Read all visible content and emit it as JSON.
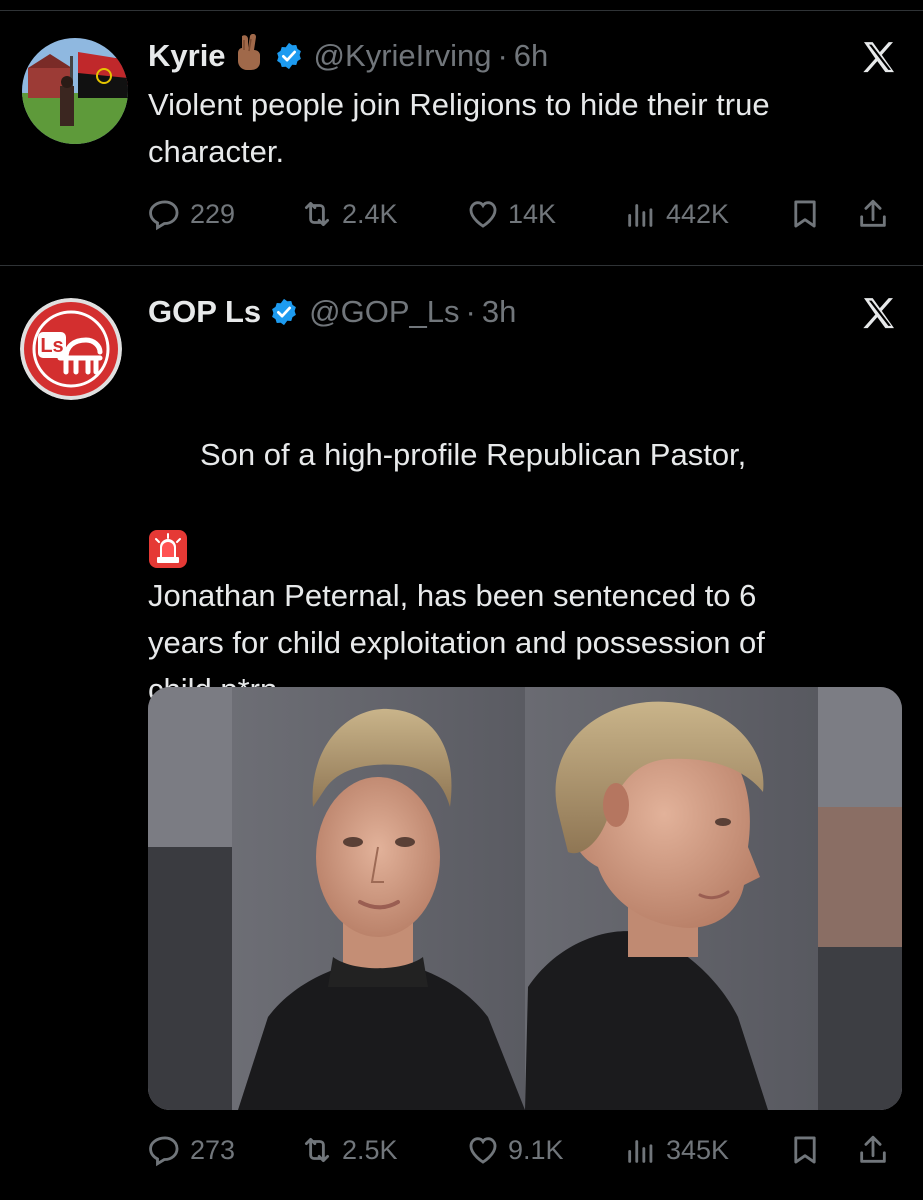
{
  "tweets": [
    {
      "name": "Kyrie",
      "handle": "@KyrieIrving",
      "separator": "·",
      "time": "6h",
      "text": "Violent people join Religions to hide their true\ncharacter.",
      "replies": "229",
      "retweets": "2.4K",
      "likes": "14K",
      "views": "442K"
    },
    {
      "name": "GOP Ls",
      "handle": "@GOP_Ls",
      "separator": "·",
      "time": "3h",
      "avatar_letters": "Ls",
      "text_line1": "Son of a high-profile Republican Pastor,",
      "text_rest": "Jonathan Peternal, has been sentenced to 6\nyears for child exploitation and possession of\nchild p*rn.\n\nHe distributed the illicit material in a\nSnapchat group called \"Diddy Disciples.\"",
      "replies": "273",
      "retweets": "2.5K",
      "likes": "9.1K",
      "views": "345K"
    }
  ],
  "icons": {
    "verified": "verified-badge-icon",
    "x_logo": "x-logo-icon",
    "reply": "reply-icon",
    "retweet": "retweet-icon",
    "like": "like-icon",
    "views": "views-icon",
    "bookmark": "bookmark-icon",
    "share": "share-icon",
    "crossed_fingers": "crossed-fingers-emoji-icon",
    "siren": "siren-emoji-icon"
  },
  "colors": {
    "background": "#000000",
    "text": "#e7e9ea",
    "muted": "#71767b",
    "verified": "#1d9bf0",
    "gop_red": "#d32f2f"
  }
}
